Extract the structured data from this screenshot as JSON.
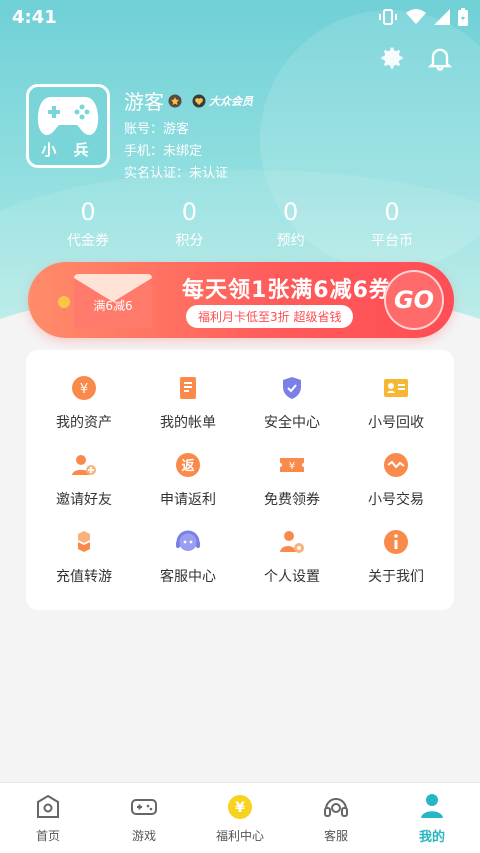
{
  "status_bar": {
    "time": "4:41"
  },
  "profile": {
    "avatar_caption": "小 兵",
    "name": "游客",
    "vip_label": "大众会员",
    "account": "账号：游客",
    "phone": "手机：未绑定",
    "realname": "实名认证：未认证"
  },
  "stats": [
    {
      "value": "0",
      "label": "代金券"
    },
    {
      "value": "0",
      "label": "积分"
    },
    {
      "value": "0",
      "label": "预约"
    },
    {
      "value": "0",
      "label": "平台币"
    }
  ],
  "banner": {
    "envelope_text": "满6减6",
    "title": "每天领1张满6减6券",
    "subtitle": "福利月卡低至3折  超级省钱",
    "go": "GO"
  },
  "menu": [
    {
      "label": "我的资产",
      "icon": "asset-icon"
    },
    {
      "label": "我的帐单",
      "icon": "bill-icon"
    },
    {
      "label": "安全中心",
      "icon": "shield-icon"
    },
    {
      "label": "小号回收",
      "icon": "id-card-icon"
    },
    {
      "label": "邀请好友",
      "icon": "invite-user-icon"
    },
    {
      "label": "申请返利",
      "icon": "rebate-icon"
    },
    {
      "label": "免费领券",
      "icon": "coupon-icon"
    },
    {
      "label": "小号交易",
      "icon": "trade-icon"
    },
    {
      "label": "充值转游",
      "icon": "cubes-icon"
    },
    {
      "label": "客服中心",
      "icon": "headset-icon"
    },
    {
      "label": "个人设置",
      "icon": "user-settings-icon"
    },
    {
      "label": "关于我们",
      "icon": "info-icon"
    }
  ],
  "tabs": [
    {
      "label": "首页",
      "icon": "home-icon"
    },
    {
      "label": "游戏",
      "icon": "gamepad-icon"
    },
    {
      "label": "福利中心",
      "icon": "yen-coin-icon"
    },
    {
      "label": "客服",
      "icon": "headphones-icon"
    },
    {
      "label": "我的",
      "icon": "person-icon",
      "active": true
    }
  ],
  "colors": {
    "primary": "#27b6c3",
    "orange": "#f98a4b",
    "banner_red": "#ff4d55"
  }
}
